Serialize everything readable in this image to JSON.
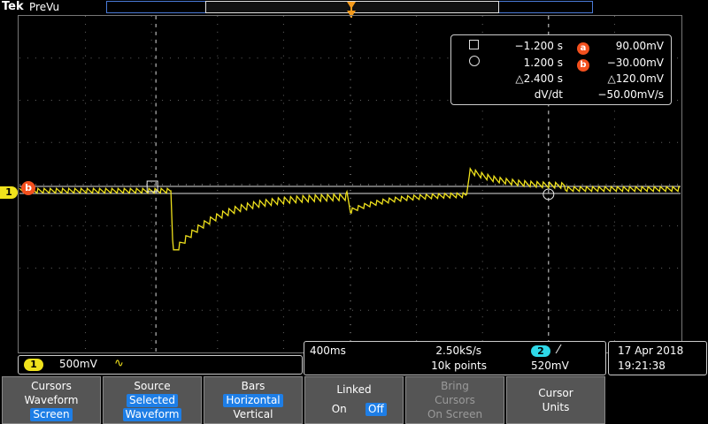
{
  "brand": {
    "name": "Tek",
    "mode": "PreVu"
  },
  "readout": {
    "cursor_a_time": "−1.200 s",
    "cursor_a_value": "90.00mV",
    "cursor_b_time": "1.200 s",
    "cursor_b_value": "−30.00mV",
    "delta_time": "△2.400 s",
    "delta_value": "△120.0mV",
    "slope_label": "dV/dt",
    "slope_value": "−50.00mV/s",
    "badge_a": "a",
    "badge_b": "b"
  },
  "channel": {
    "number": "1",
    "scale": "500mV",
    "coupling_symbol": "∿",
    "ground_marker": "1",
    "cursor_marker": "b",
    "color": "#f0e21c"
  },
  "acquisition": {
    "timebase": "400ms",
    "sample_rate": "2.50kS/s",
    "record_length": "10k points",
    "trigger_channel": "2",
    "trigger_slope": "⁄",
    "trigger_level": "520mV"
  },
  "datetime": {
    "date": "17 Apr  2018",
    "time": "19:21:38"
  },
  "softkeys": [
    {
      "id": "cursors",
      "lines": [
        "Cursors",
        "Waveform"
      ],
      "selected": "Screen"
    },
    {
      "id": "source",
      "lines": [
        "Source"
      ],
      "selected_lines": [
        "Selected",
        "Waveform"
      ]
    },
    {
      "id": "bars",
      "lines": [
        "Bars"
      ],
      "selected": "Horizontal",
      "extra": "Vertical"
    },
    {
      "id": "linked",
      "lines": [
        "Linked"
      ],
      "on": "On",
      "off": "Off"
    },
    {
      "id": "bring",
      "lines": [
        "Bring",
        "Cursors",
        "On Screen"
      ]
    },
    {
      "id": "units",
      "lines": [
        "Cursor",
        "Units"
      ]
    }
  ],
  "colors": {
    "trace": "#f0e21c",
    "accent": "#1e7ee6",
    "cursor_badge": "#f2501e",
    "trigger_marker": "#f39a1c"
  }
}
